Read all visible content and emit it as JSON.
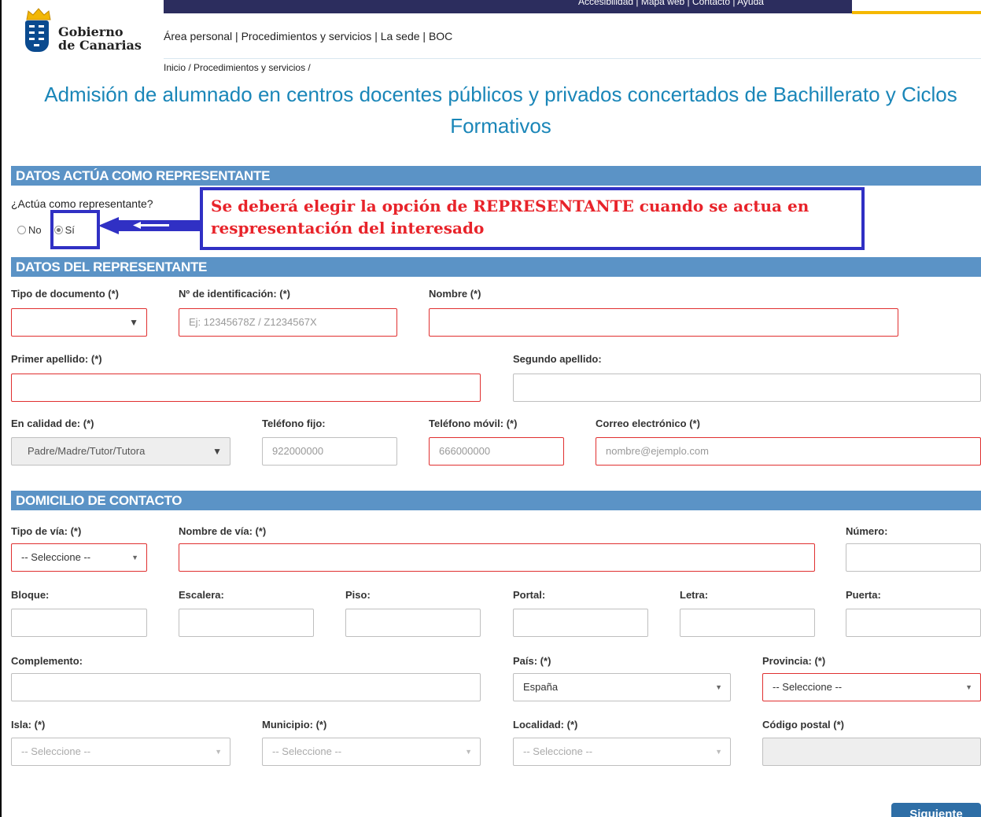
{
  "topbar": {
    "links": "Accesibilidad  |  Mapa web  |  Contacto  |  Ayuda"
  },
  "logo": {
    "line1": "Gobierno",
    "line2": "de Canarias"
  },
  "nav": {
    "items": "Área personal | Procedimientos y servicios | La sede | BOC"
  },
  "breadcrumb": "Inicio / Procedimientos y servicios /",
  "page_title": "Admisión de alumnado en centros docentes públicos y privados concertados de Bachillerato y Ciclos Formativos",
  "sections": {
    "representante_q": "DATOS ACTÚA COMO REPRESENTANTE",
    "representante": "DATOS DEL REPRESENTANTE",
    "domicilio": "DOMICILIO DE CONTACTO"
  },
  "question": {
    "label": "¿Actúa como representante?",
    "options": [
      "No",
      "Sí"
    ],
    "selected": "Sí"
  },
  "callout": {
    "line1": "Se deberá elegir la opción de REPRESENTANTE cuando se actua en",
    "line2": "respresentación del interesado"
  },
  "representante": {
    "tipo_doc_label": "Tipo de documento (*)",
    "tipo_doc_value": "",
    "num_id_label": "Nº de identificación: (*)",
    "num_id_placeholder": "Ej: 12345678Z / Z1234567X",
    "nombre_label": "Nombre (*)",
    "primer_apellido_label": "Primer apellido: (*)",
    "segundo_apellido_label": "Segundo apellido:",
    "calidad_label": "En calidad de: (*)",
    "calidad_value": "Padre/Madre/Tutor/Tutora",
    "tel_fijo_label": "Teléfono fijo:",
    "tel_fijo_placeholder": "922000000",
    "tel_movil_label": "Teléfono móvil: (*)",
    "tel_movil_placeholder": "666000000",
    "correo_label": "Correo electrónico (*)",
    "correo_placeholder": "nombre@ejemplo.com"
  },
  "domicilio": {
    "tipo_via_label": "Tipo de vía: (*)",
    "tipo_via_value": "-- Seleccione --",
    "nombre_via_label": "Nombre de vía: (*)",
    "numero_label": "Número:",
    "bloque_label": "Bloque:",
    "escalera_label": "Escalera:",
    "piso_label": "Piso:",
    "portal_label": "Portal:",
    "letra_label": "Letra:",
    "puerta_label": "Puerta:",
    "complemento_label": "Complemento:",
    "pais_label": "País: (*)",
    "pais_value": "España",
    "provincia_label": "Provincia: (*)",
    "provincia_value": "-- Seleccione --",
    "isla_label": "Isla: (*)",
    "isla_value": "-- Seleccione --",
    "municipio_label": "Municipio: (*)",
    "municipio_value": "-- Seleccione --",
    "localidad_label": "Localidad: (*)",
    "localidad_value": "-- Seleccione --",
    "cp_label": "Código postal (*)"
  },
  "buttons": {
    "next": "Siguiente"
  },
  "colors": {
    "section_header": "#5b93c6",
    "title": "#1a86b8",
    "required_border": "#e03030",
    "callout_border": "#3030c4",
    "callout_text": "#e8232a"
  }
}
